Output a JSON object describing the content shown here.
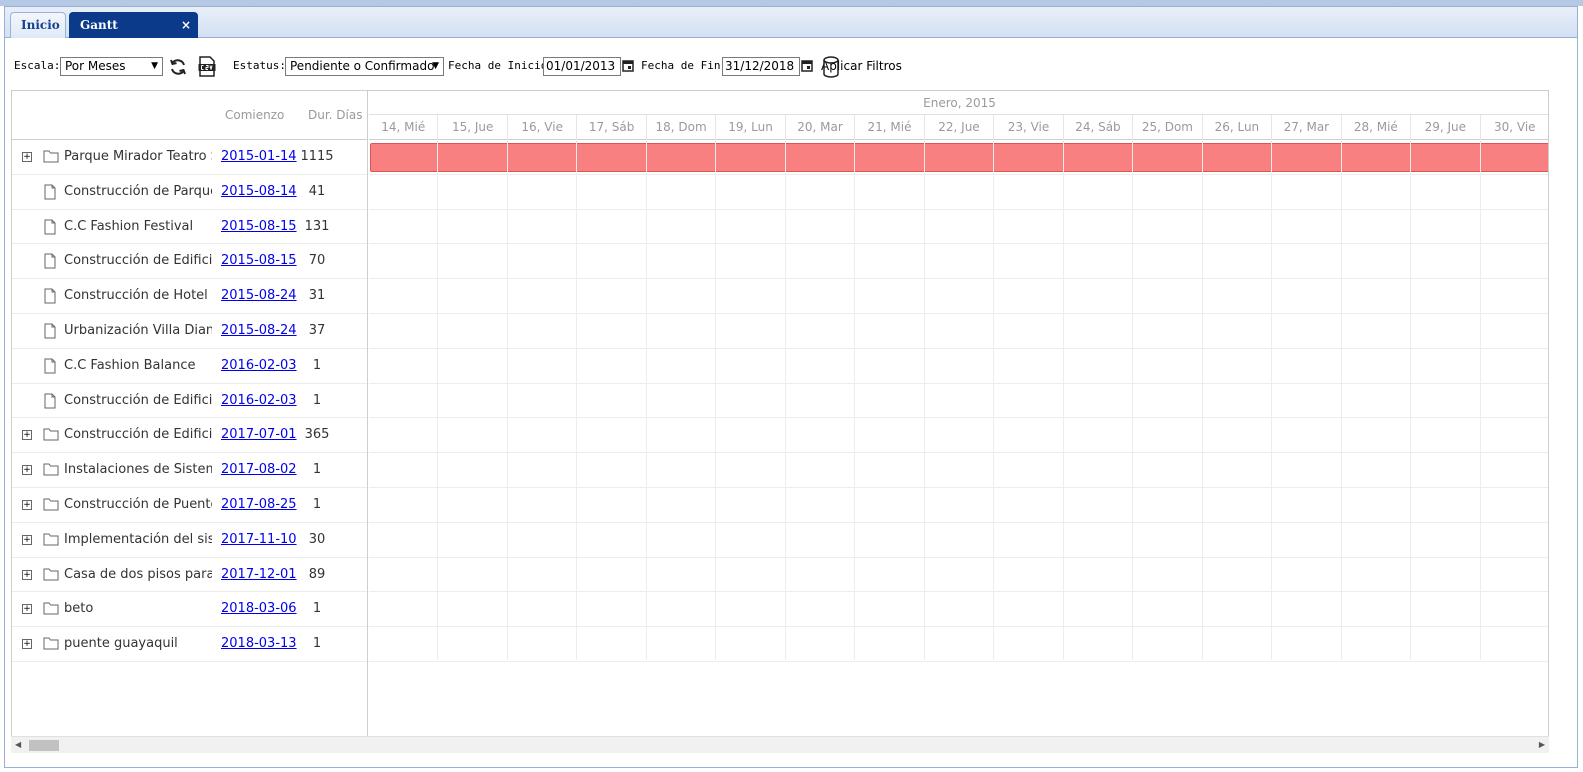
{
  "tabs": [
    {
      "label": "Inicio"
    },
    {
      "label": "Gantt Proyectos",
      "close": "×"
    }
  ],
  "toolbar": {
    "escala_label": "Escala:",
    "escala_value": "Por Meses",
    "estatus_label": "Estatus:",
    "estatus_value": "Pendiente o Confirmado",
    "fecha_inicio_label": "Fecha de Inicio:",
    "fecha_inicio_value": "01/01/2013",
    "fecha_fin_label": "Fecha de Fin:",
    "fecha_fin_value": "31/12/2018",
    "apply_label": "Aplicar Filtros",
    "dropdown_arrow": "▼"
  },
  "grid": {
    "col_start": "Comienzo",
    "col_dur": "Dur. Días",
    "rows": [
      {
        "name": "Parque Mirador Teatro S",
        "start": "2015-01-14",
        "dur": "1115",
        "type": "folder"
      },
      {
        "name": "Construcción de Parque",
        "start": "2015-08-14",
        "dur": "41",
        "type": "file"
      },
      {
        "name": "C.C Fashion Festival",
        "start": "2015-08-15",
        "dur": "131",
        "type": "file"
      },
      {
        "name": "Construcción de Edificio",
        "start": "2015-08-15",
        "dur": "70",
        "type": "file"
      },
      {
        "name": "Construcción de Hotel",
        "start": "2015-08-24",
        "dur": "31",
        "type": "file"
      },
      {
        "name": "Urbanización Villa Diana",
        "start": "2015-08-24",
        "dur": "37",
        "type": "file"
      },
      {
        "name": "C.C Fashion Balance",
        "start": "2016-02-03",
        "dur": "1",
        "type": "file"
      },
      {
        "name": "Construcción de Edificio",
        "start": "2016-02-03",
        "dur": "1",
        "type": "file"
      },
      {
        "name": "Construcción de Edificio",
        "start": "2017-07-01",
        "dur": "365",
        "type": "folder"
      },
      {
        "name": "Instalaciones de Sistema",
        "start": "2017-08-02",
        "dur": "1",
        "type": "folder"
      },
      {
        "name": "Construcción de Puento",
        "start": "2017-08-25",
        "dur": "1",
        "type": "folder"
      },
      {
        "name": "Implementación del siste",
        "start": "2017-11-10",
        "dur": "30",
        "type": "folder"
      },
      {
        "name": "Casa de dos pisos para",
        "start": "2017-12-01",
        "dur": "89",
        "type": "folder"
      },
      {
        "name": "beto",
        "start": "2018-03-06",
        "dur": "1",
        "type": "folder"
      },
      {
        "name": "puente guayaquil",
        "start": "2018-03-13",
        "dur": "1",
        "type": "folder"
      }
    ],
    "expander_symbol": "+"
  },
  "timeline": {
    "month": "Enero, 2015",
    "days": [
      "14, Mié",
      "15, Jue",
      "16, Vie",
      "17, Sáb",
      "18, Dom",
      "19, Lun",
      "20, Mar",
      "21, Mié",
      "22, Jue",
      "23, Vie",
      "24, Sáb",
      "25, Dom",
      "26, Lun",
      "27, Mar",
      "28, Mié",
      "29, Jue",
      "30, Vie"
    ]
  },
  "scrollbar": {
    "left": "◀",
    "right": "▶"
  },
  "colors": {
    "bar": "#f98080",
    "active_tab": "#0c3a8a",
    "link": "#0000ee"
  }
}
